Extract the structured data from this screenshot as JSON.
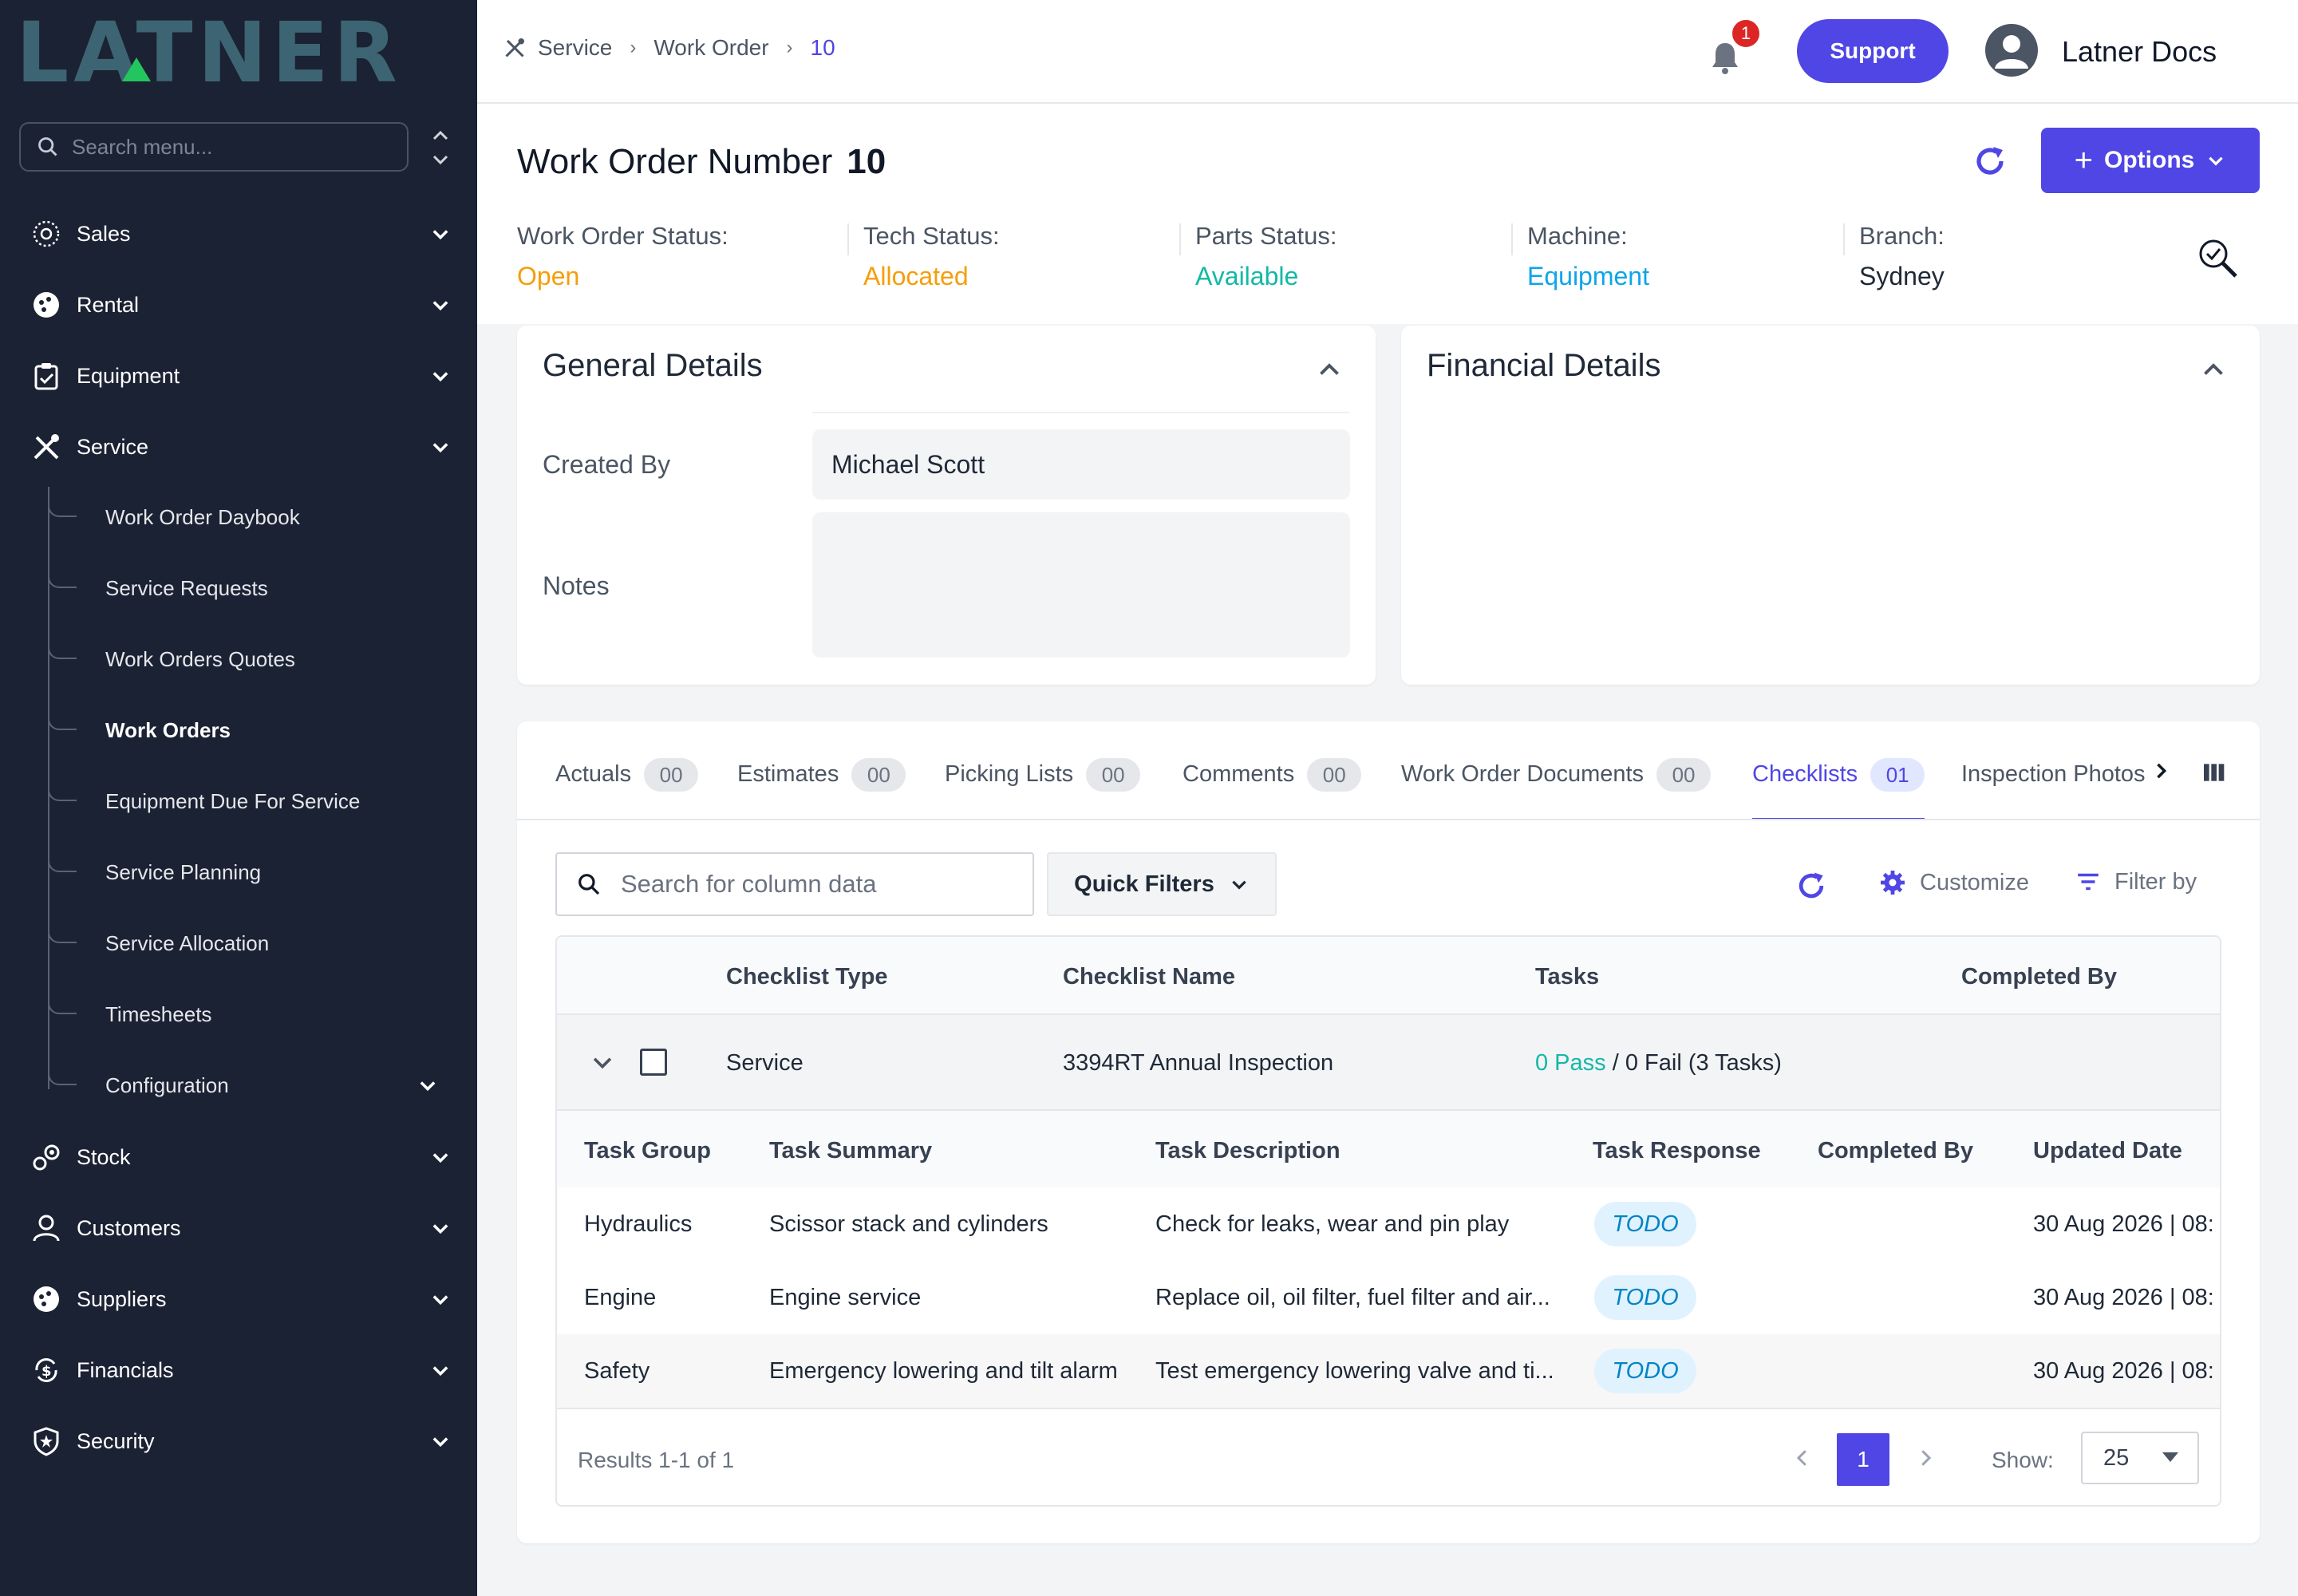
{
  "app": {
    "logo_text": "LATNER"
  },
  "sidebar": {
    "search_placeholder": "Search menu...",
    "items": [
      {
        "label": "Sales",
        "icon": "chart-icon"
      },
      {
        "label": "Rental",
        "icon": "rental-icon"
      },
      {
        "label": "Equipment",
        "icon": "clipboard-icon"
      },
      {
        "label": "Service",
        "icon": "tools-icon"
      },
      {
        "label": "Stock",
        "icon": "stock-icon"
      },
      {
        "label": "Customers",
        "icon": "user-icon"
      },
      {
        "label": "Suppliers",
        "icon": "supplier-icon"
      },
      {
        "label": "Financials",
        "icon": "dollar-icon"
      },
      {
        "label": "Security",
        "icon": "shield-icon"
      }
    ],
    "service_sub": [
      "Work Order Daybook",
      "Service Requests",
      "Work Orders Quotes",
      "Work Orders",
      "Equipment Due For Service",
      "Service Planning",
      "Service Allocation",
      "Timesheets",
      "Configuration"
    ]
  },
  "topbar": {
    "breadcrumb": [
      "Service",
      "Work Order",
      "10"
    ],
    "notification_count": "1",
    "support_label": "Support",
    "user_name": "Latner Docs"
  },
  "header": {
    "title_label": "Work Order Number",
    "title_number": "10",
    "options_label": "Options",
    "statuses": [
      {
        "label": "Work Order Status:",
        "value": "Open",
        "color": "#f59e0b"
      },
      {
        "label": "Tech Status:",
        "value": "Allocated",
        "color": "#f59e0b"
      },
      {
        "label": "Parts Status:",
        "value": "Available",
        "color": "#14b8a6"
      },
      {
        "label": "Machine:",
        "value": "Equipment",
        "color": "#0ea5e9"
      },
      {
        "label": "Branch:",
        "value": "Sydney",
        "color": "#1f2937"
      }
    ]
  },
  "general_details": {
    "title": "General Details",
    "created_by_label": "Created By",
    "created_by_value": "Michael Scott",
    "notes_label": "Notes",
    "notes_value": ""
  },
  "financial_details": {
    "title": "Financial Details"
  },
  "tabs": [
    {
      "label": "Actuals",
      "count": "00"
    },
    {
      "label": "Estimates",
      "count": "00"
    },
    {
      "label": "Picking Lists",
      "count": "00"
    },
    {
      "label": "Comments",
      "count": "00"
    },
    {
      "label": "Work Order Documents",
      "count": "00"
    },
    {
      "label": "Checklists",
      "count": "01",
      "active": true
    },
    {
      "label": "Inspection Photos",
      "count": ""
    }
  ],
  "toolbar": {
    "search_placeholder": "Search for column data",
    "quick_filters_label": "Quick Filters",
    "customize_label": "Customize",
    "filter_by_label": "Filter by"
  },
  "table": {
    "columns": [
      "Checklist Type",
      "Checklist Name",
      "Tasks",
      "Completed By"
    ],
    "row": {
      "type": "Service",
      "name": "3394RT Annual Inspection",
      "tasks_pass": "0 Pass",
      "tasks_rest": " / 0 Fail (3 Tasks)",
      "completed_by": ""
    },
    "sub_columns": [
      "Task Group",
      "Task Summary",
      "Task Description",
      "Task Response",
      "Completed By",
      "Updated Date"
    ],
    "sub_rows": [
      {
        "group": "Hydraulics",
        "summary": "Scissor stack and cylinders",
        "description": "Check for leaks, wear and pin play",
        "response": "TODO",
        "completed_by": "",
        "updated": "30 Aug 2026 | 08:"
      },
      {
        "group": "Engine",
        "summary": "Engine service",
        "description": "Replace oil, oil filter, fuel filter and air...",
        "response": "TODO",
        "completed_by": "",
        "updated": "30 Aug 2026 | 08:"
      },
      {
        "group": "Safety",
        "summary": "Emergency lowering and tilt alarm",
        "description": "Test emergency lowering valve and ti...",
        "response": "TODO",
        "completed_by": "",
        "updated": "30 Aug 2026 | 08:"
      }
    ]
  },
  "pagination": {
    "results_text": "Results 1-1 of 1",
    "current_page": "1",
    "show_label": "Show:",
    "page_size": "25"
  }
}
